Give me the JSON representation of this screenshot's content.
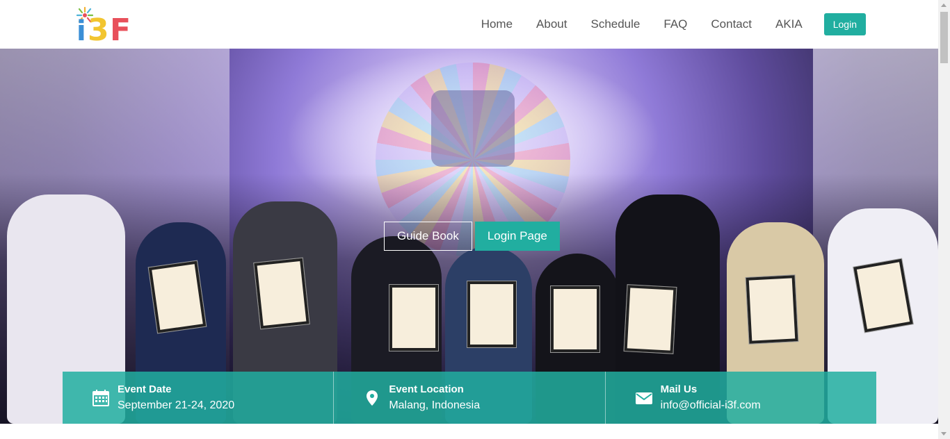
{
  "header": {
    "logo_text": "i3F",
    "nav": [
      {
        "label": "Home"
      },
      {
        "label": "About"
      },
      {
        "label": "Schedule"
      },
      {
        "label": "FAQ"
      },
      {
        "label": "Contact"
      },
      {
        "label": "AKIA"
      }
    ],
    "login_label": "Login"
  },
  "hero": {
    "guide_button": "Guide Book",
    "login_page_button": "Login Page"
  },
  "info_bar": {
    "items": [
      {
        "icon": "calendar-icon",
        "title": "Event Date",
        "value": "September 21-24, 2020"
      },
      {
        "icon": "map-pin-icon",
        "title": "Event Location",
        "value": "Malang, Indonesia"
      },
      {
        "icon": "envelope-icon",
        "title": "Mail Us",
        "value": "info@official-i3f.com"
      }
    ]
  },
  "colors": {
    "accent": "#21aea0",
    "nav_text": "#555555",
    "white": "#ffffff"
  }
}
